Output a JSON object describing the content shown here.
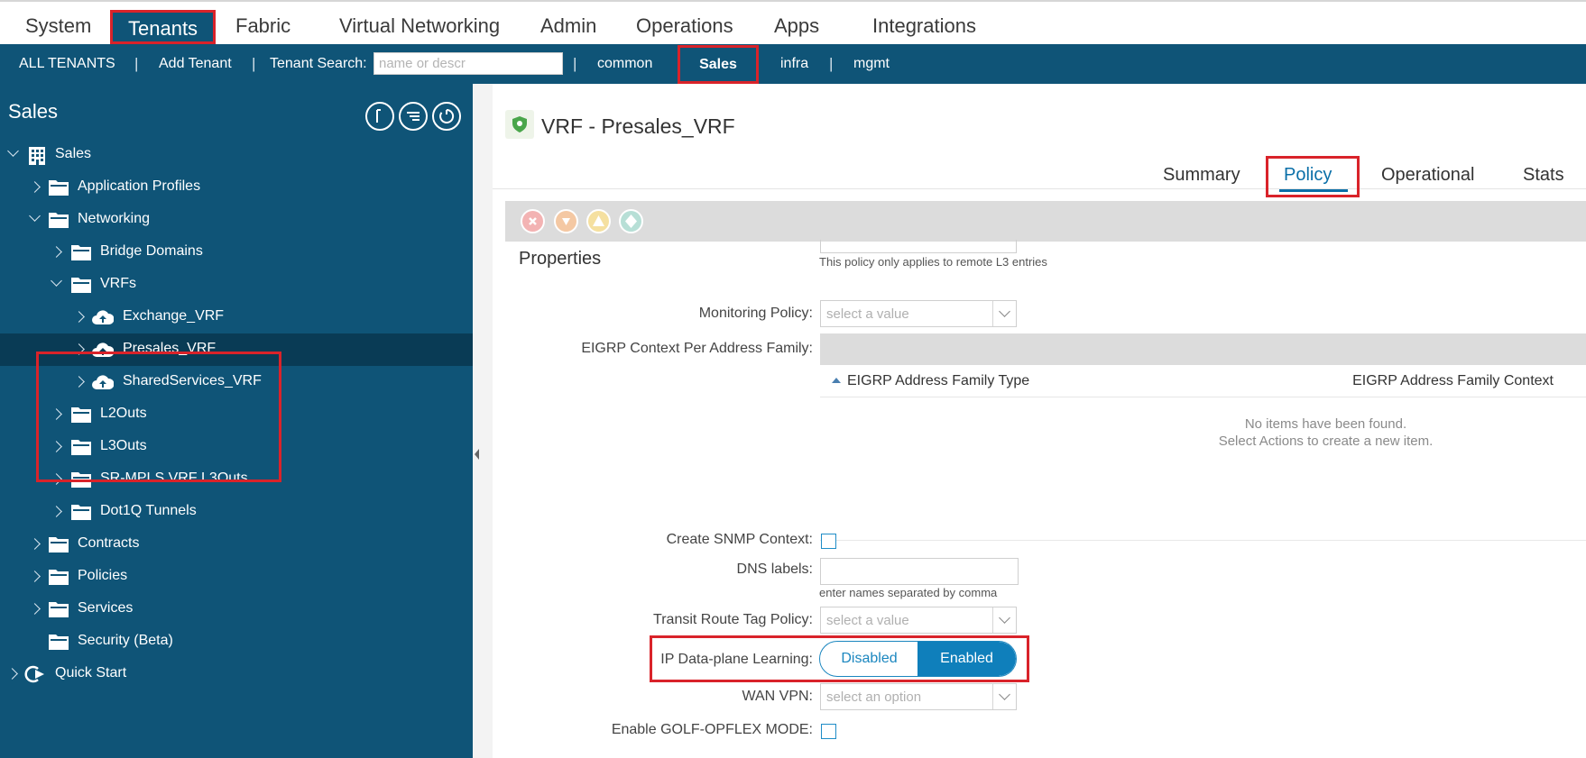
{
  "topnav": {
    "items": [
      "System",
      "Tenants",
      "Fabric",
      "Virtual Networking",
      "Admin",
      "Operations",
      "Apps",
      "Integrations"
    ]
  },
  "subnav": {
    "all_tenants": "ALL TENANTS",
    "add_tenant": "Add Tenant",
    "tenant_search_label": "Tenant Search:",
    "tenant_search_placeholder": "name or descr",
    "tenants": [
      "common",
      "Sales",
      "infra",
      "mgmt"
    ],
    "separator": "|"
  },
  "sidebar": {
    "title": "Sales",
    "tree": [
      {
        "label": "Sales",
        "icon": "building-icon"
      },
      {
        "label": "Application Profiles",
        "icon": "folder-icon"
      },
      {
        "label": "Networking",
        "icon": "folder-icon"
      },
      {
        "label": "Bridge Domains",
        "icon": "folder-icon"
      },
      {
        "label": "VRFs",
        "icon": "folder-icon"
      },
      {
        "label": "Exchange_VRF",
        "icon": "vrf-cloud-icon"
      },
      {
        "label": "Presales_VRF",
        "icon": "vrf-cloud-icon"
      },
      {
        "label": "SharedServices_VRF",
        "icon": "vrf-cloud-icon"
      },
      {
        "label": "L2Outs",
        "icon": "folder-icon"
      },
      {
        "label": "L3Outs",
        "icon": "folder-icon"
      },
      {
        "label": "SR-MPLS VRF L3Outs",
        "icon": "folder-icon"
      },
      {
        "label": "Dot1Q Tunnels",
        "icon": "folder-icon"
      },
      {
        "label": "Contracts",
        "icon": "folder-icon"
      },
      {
        "label": "Policies",
        "icon": "folder-icon"
      },
      {
        "label": "Services",
        "icon": "folder-icon"
      },
      {
        "label": "Security (Beta)",
        "icon": "folder-icon"
      },
      {
        "label": "Quick Start",
        "icon": "quick-start-icon"
      }
    ]
  },
  "main": {
    "title": "VRF - Presales_VRF",
    "tabs": [
      "Summary",
      "Policy",
      "Operational",
      "Stats"
    ],
    "active_tab": "Policy",
    "properties_title": "Properties",
    "remote_l3_note": "This policy only applies to remote L3 entries",
    "monitoring_policy": {
      "label": "Monitoring Policy:",
      "placeholder": "select a value"
    },
    "eigrp": {
      "label": "EIGRP Context Per Address Family:",
      "col1": "EIGRP Address Family Type",
      "col2": "EIGRP Address Family Context",
      "empty_line1": "No items have been found.",
      "empty_line2": "Select Actions to create a new item."
    },
    "snmp_label": "Create SNMP Context:",
    "dns_label": "DNS labels:",
    "dns_note": "enter names separated by comma",
    "transit_label": "Transit Route Tag Policy:",
    "transit_placeholder": "select a value",
    "ip_learning": {
      "label": "IP Data-plane Learning:",
      "off": "Disabled",
      "on": "Enabled",
      "selected": "Enabled"
    },
    "wan_vpn": {
      "label": "WAN VPN:",
      "placeholder": "select an option"
    },
    "golf_label": "Enable GOLF-OPFLEX MODE:"
  },
  "colors": {
    "accent": "#0f5477",
    "highlight": "#d9232a",
    "link": "#0a6fa8"
  }
}
